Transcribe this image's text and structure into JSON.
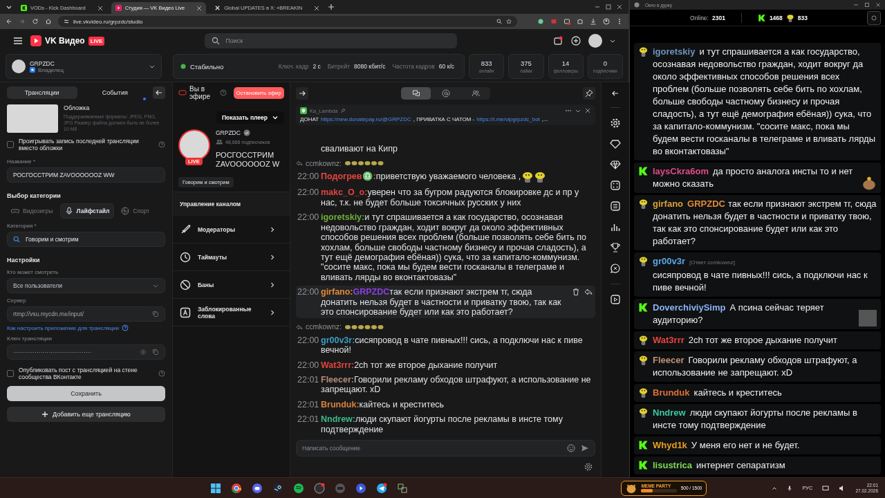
{
  "browser": {
    "tabs": [
      {
        "title": "VODs - Kick Dashboard",
        "kind": "kick",
        "selected": false
      },
      {
        "title": "Студия — VK Видео Live",
        "kind": "vk",
        "selected": true
      },
      {
        "title": "Global UPDATES в X: «BREAKIN",
        "kind": "x",
        "selected": false
      }
    ],
    "address": "live.vkvideo.ru/grpzdc/studio"
  },
  "header": {
    "logo": "VK Видео",
    "badge": "LIVE",
    "search": {
      "placeholder": "Поиск"
    }
  },
  "account": {
    "name": "GRPZDC",
    "role": "Владелец"
  },
  "status": {
    "label": "Стабильно",
    "stats": [
      {
        "label": "Ключ. кадр",
        "value": "2 с"
      },
      {
        "label": "Битрейт",
        "value": "8080 кбит/с"
      },
      {
        "label": "Частота кадров",
        "value": "60 к/с"
      }
    ]
  },
  "counters": [
    {
      "value": "833",
      "label": "онлайн"
    },
    {
      "value": "375",
      "label": "лайки"
    },
    {
      "value": "14",
      "label": "фолловеры"
    },
    {
      "value": "0",
      "label": "подписчики"
    }
  ],
  "settings_panel": {
    "tabs": [
      {
        "label": "Трансляции",
        "selected": true,
        "dot": false
      },
      {
        "label": "События",
        "selected": false,
        "dot": true
      }
    ],
    "cover": {
      "title": "Обложка",
      "hint": "Поддерживаемые форматы: JPEG, PNG, JPG Размер файла должен быть не более 10 Мб"
    },
    "replay_checkbox": {
      "label": "Проигрывать запись последней трансляции вместо обложки",
      "checked": false
    },
    "name_field": {
      "label": "Название *",
      "value": "РОСГОССТРИМ ZAVOOOOOOZ WW"
    },
    "category_title": "Выбор категории",
    "category_tabs": [
      {
        "label": "Видеоигры",
        "kind": "gamepad",
        "selected": false
      },
      {
        "label": "Лайфстайл",
        "kind": "mic",
        "selected": true
      },
      {
        "label": "Спорт",
        "kind": "ball",
        "selected": false
      }
    ],
    "category_field": {
      "label": "Категория *",
      "value": "Говорим и смотрим"
    },
    "settings_title": "Настройки",
    "audience_field": {
      "label": "Кто может смотреть",
      "value": "Все пользователи"
    },
    "server_field": {
      "label": "Сервер",
      "value": "rtmp://vsu.mycdn.me/input/"
    },
    "help_link": "Как настроить приложение для трансляции",
    "key_field": {
      "label": "Ключ трансляции",
      "value": "········································"
    },
    "publish_checkbox": {
      "label": "Опубликовать пост с трансляцией на стене сообщества ВКонтакте",
      "checked": false
    },
    "save_button": "Сохранить",
    "add_button": "Добавить еще трансляцию"
  },
  "live_panel": {
    "status": "Вы в эфире",
    "stop_button": "Остановить эфир",
    "player_button": "Показать плеер",
    "channel": {
      "name": "GRPZDC",
      "verified": true,
      "subscribers": "48,666 подписчиков",
      "badge": "LIVE",
      "title": "РОСГОССТРИМ ZAVOOOOOOZ W"
    },
    "category_tag": "Говорим и смотрим",
    "manage_title": "Управление каналом",
    "manage_items": [
      {
        "label": "Модераторы",
        "kind": "sword"
      },
      {
        "label": "Таймауты",
        "kind": "clock"
      },
      {
        "label": "Баны",
        "kind": "ban"
      },
      {
        "label": "Заблокированные слова",
        "kind": "letter"
      }
    ]
  },
  "chat": {
    "tabs": [
      {
        "kind": "chat",
        "selected": true
      },
      {
        "kind": "mention",
        "selected": false
      },
      {
        "kind": "users",
        "selected": false
      }
    ],
    "pinned": {
      "author": "Ka_Lambda",
      "parts": [
        {
          "kind": "text",
          "text": "ДОНАТ"
        },
        {
          "kind": "link",
          "text": "https://new.donatepay.ru/@GRPZDC"
        },
        {
          "kind": "text",
          "text": ", ПРИВАТКА С ЧАТОМ -"
        },
        {
          "kind": "link",
          "text": "https://t.me/vipgrpzdc_bot"
        },
        {
          "kind": "text",
          "text": ",..."
        }
      ]
    },
    "messages": [
      {
        "kind": "continuation",
        "text": "сваливают на Кипр",
        "highlighted": false
      },
      {
        "kind": "reply",
        "author": "ccmkownz:",
        "highlighted": false
      },
      {
        "kind": "message",
        "time": "22:00",
        "author": "Подогрев♎:",
        "color": "#e8453c",
        "text": "приветствую уважаемого человека ,",
        "attachments": [
          {
            "kind": "emote"
          },
          {
            "kind": "emote"
          }
        ],
        "highlighted": false
      },
      {
        "kind": "message",
        "time": "22:00",
        "author": "makc_O_o:",
        "color": "#e0443e",
        "text": "уверен что за бугром радуются блокировке дс и пр у нас, т.к. не будет больше токсичных русских у них",
        "highlighted": false
      },
      {
        "kind": "message",
        "time": "22:00",
        "author": "igoretskiy:",
        "color": "#6fae3a",
        "text": "и тут спрашивается а как государство, осознавая недовольство граждан, ходит вокруг да около эффективных способов решения всех проблем (больше позволять себе бить по хохлам, больше свободы частному бизнесу и прочая сладость), а тут ещё демография ебёная)) сука, что за капитало-коммунизм. \"сосите макс, пока мы будем вести госканалы в телеграме и вливать лярды во вконтактовазы\"",
        "highlighted": false
      },
      {
        "kind": "message",
        "time": "22:00",
        "author": "girfano:",
        "color": "#e08a3a",
        "mention": "GRPZDC",
        "text": "так если признают экстрем тг, сюда донатить нельзя будет в частности и приватку твою, так как это спонсирование будет или как это работает?",
        "highlighted": true
      },
      {
        "kind": "reply",
        "author": "ccmkownz:",
        "highlighted": false
      },
      {
        "kind": "message",
        "time": "22:00",
        "author": "gr00v3r:",
        "color": "#3a9ec8",
        "text": "сисяпровод в чате пивных!!! сись, а подключи нас к пиве вечной!",
        "highlighted": false
      },
      {
        "kind": "message",
        "time": "22:00",
        "author": "Wat3rrr:",
        "color": "#e0443e",
        "text": "2ch тот же второе дыхание получит",
        "highlighted": false
      },
      {
        "kind": "message",
        "time": "22:01",
        "author": "Fleecer:",
        "color": "#b58b7a",
        "text": "Говорили рекламу обходов штрафуют, а использование не запрещают. xD",
        "highlighted": false
      },
      {
        "kind": "message",
        "time": "22:01",
        "author": "Brunduk:",
        "color": "#d9823a",
        "text": "кайтесь и креститесь",
        "highlighted": false
      },
      {
        "kind": "message",
        "time": "22:01",
        "author": "Nndrew:",
        "color": "#3cb98a",
        "text": "люди скупают йогурты после рекламы в инсте тому подтверждение",
        "highlighted": false
      }
    ],
    "input": {
      "placeholder": "Написать сообщение"
    }
  },
  "overlay_window": {
    "title": "Окно в дурку",
    "online_label": "Online:",
    "online": "2301",
    "kick_count": "1468",
    "vk_count": "833",
    "messages": [
      {
        "kind": "vk",
        "author": "igoretskiy",
        "color": "#6f93c0",
        "text": "и тут спрашивается а как государство, осознавая недовольство граждан, ходит вокруг да около эффективных способов решения всех проблем (больше позволять себе бить по хохлам, больше свободы частному бизнесу и прочая сладость), а тут ещё демография ебёная)) сука, что за капитало-коммунизм. \"сосите макс, пока мы будем вести госканалы в телеграме и вливать лярды во вконтактовазы\""
      },
      {
        "kind": "kick",
        "author": "laysCkra6om",
        "color": "#e04a8a",
        "text": "да просто аналога инсты то и нет можно сказать",
        "attachments": [
          {
            "kind": "emote"
          }
        ]
      },
      {
        "kind": "vk",
        "author": "girfano",
        "color": "#d9a03a",
        "mention": "GRPZDC",
        "text": "так если признают экстрем тг, сюда донатить нельзя будет в частности и приватку твою, так как это спонсирование будет или как это работает?"
      },
      {
        "kind": "vk",
        "author": "gr00v3r",
        "color": "#5aa8e8",
        "reply": "[Ответ ccmkownz]",
        "text": "сисяпровод в чате пивных!!! сись, а подключи нас к пиве вечной!"
      },
      {
        "kind": "kick",
        "author": "DoverchiviySimp",
        "color": "#8ab4f8",
        "text": "А псина сейчас теряет аудиторию?",
        "attachments": [
          {
            "kind": "photo"
          }
        ]
      },
      {
        "kind": "vk",
        "author": "Wat3rrr",
        "color": "#e8453c",
        "text": "2ch тот же второе дыхание получит"
      },
      {
        "kind": "vk",
        "author": "Fleecer",
        "color": "#c0907a",
        "text": "Говорили рекламу обходов штрафуют, а использование не запрещают. xD"
      },
      {
        "kind": "vk",
        "author": "Brunduk",
        "color": "#e0703a",
        "text": "кайтесь и креститесь"
      },
      {
        "kind": "vk",
        "author": "Nndrew",
        "color": "#3cc8a0",
        "text": "люди скупают йогурты после рекламы в инсте тому подтверждение"
      },
      {
        "kind": "kick",
        "author": "Whyd1k",
        "color": "#e8a020",
        "text": "У меня его нет и не будет."
      },
      {
        "kind": "kick",
        "author": "lisustrica",
        "color": "#7ed957",
        "text": "интернет сепаратизм"
      }
    ]
  },
  "taskbar": {
    "widget": {
      "title": "MEME PARTY",
      "reading": "500 / 1500",
      "level": 0.33
    },
    "language": "РУС",
    "time": "22:01",
    "date": "27.02.2026"
  }
}
